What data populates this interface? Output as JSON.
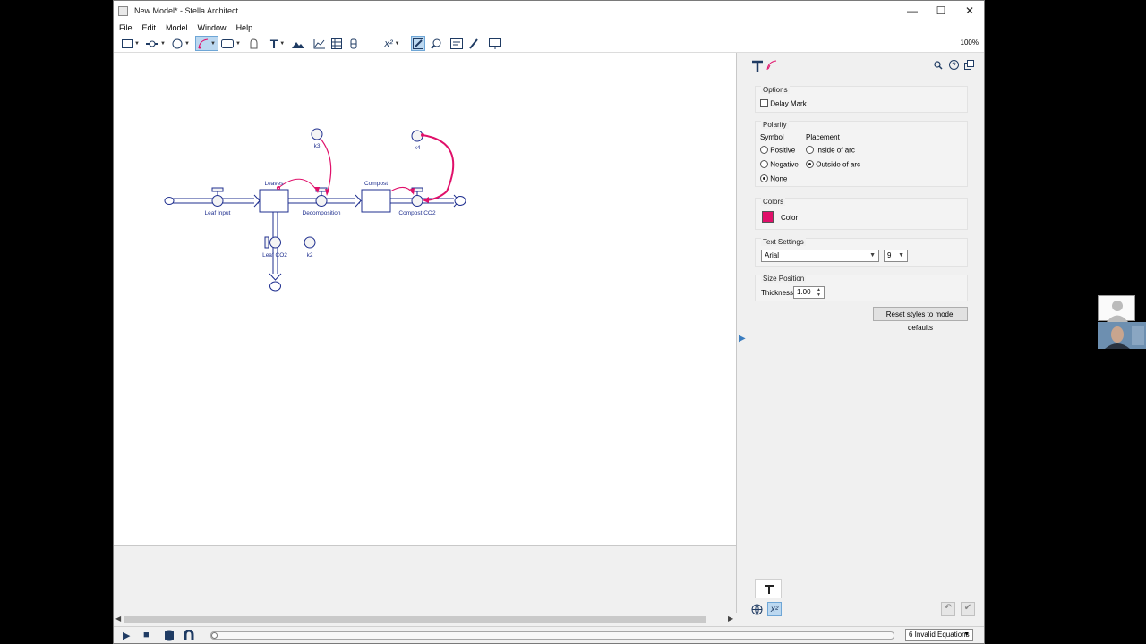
{
  "window": {
    "title": "New Model* - Stella Architect",
    "minimize": "—",
    "maximize": "☐",
    "close": "✕"
  },
  "menu": [
    "File",
    "Edit",
    "Model",
    "Window",
    "Help"
  ],
  "toolbar": {
    "zoom": "100%",
    "text_tool": "T",
    "equation_tool": "x²"
  },
  "model": {
    "stocks": [
      {
        "label": "Leaves"
      },
      {
        "label": "Compost"
      }
    ],
    "flows": [
      {
        "label": "Leaf Input"
      },
      {
        "label": "Decomposition"
      },
      {
        "label": "Compost CO2"
      },
      {
        "label": "Leaf CO2"
      }
    ],
    "converters": [
      {
        "label": "k3"
      },
      {
        "label": "k4"
      },
      {
        "label": "k2"
      }
    ]
  },
  "panel": {
    "options": {
      "title": "Options",
      "delay_mark_label": "Delay Mark",
      "delay_mark_checked": false
    },
    "polarity": {
      "title": "Polarity",
      "symbol_heading": "Symbol",
      "placement_heading": "Placement",
      "symbol_options": [
        "Positive",
        "Negative",
        "None"
      ],
      "symbol_selected": "None",
      "placement_options": [
        "Inside of arc",
        "Outside of arc"
      ],
      "placement_selected": "Outside of arc"
    },
    "colors": {
      "title": "Colors",
      "color_label": "Color",
      "swatch": "#e0106a"
    },
    "text_settings": {
      "title": "Text Settings",
      "font": "Arial",
      "size": "9"
    },
    "size_position": {
      "title": "Size  Position",
      "thickness_label": "Thickness",
      "thickness_value": "1.00"
    },
    "reset_button": "Reset styles to model defaults"
  },
  "status": {
    "invalid_equations": "6 Invalid Equations"
  },
  "colors": {
    "connector": "#e0106a",
    "diagram": "#1f2f8f",
    "converter_fill": "#f4f4f4"
  }
}
